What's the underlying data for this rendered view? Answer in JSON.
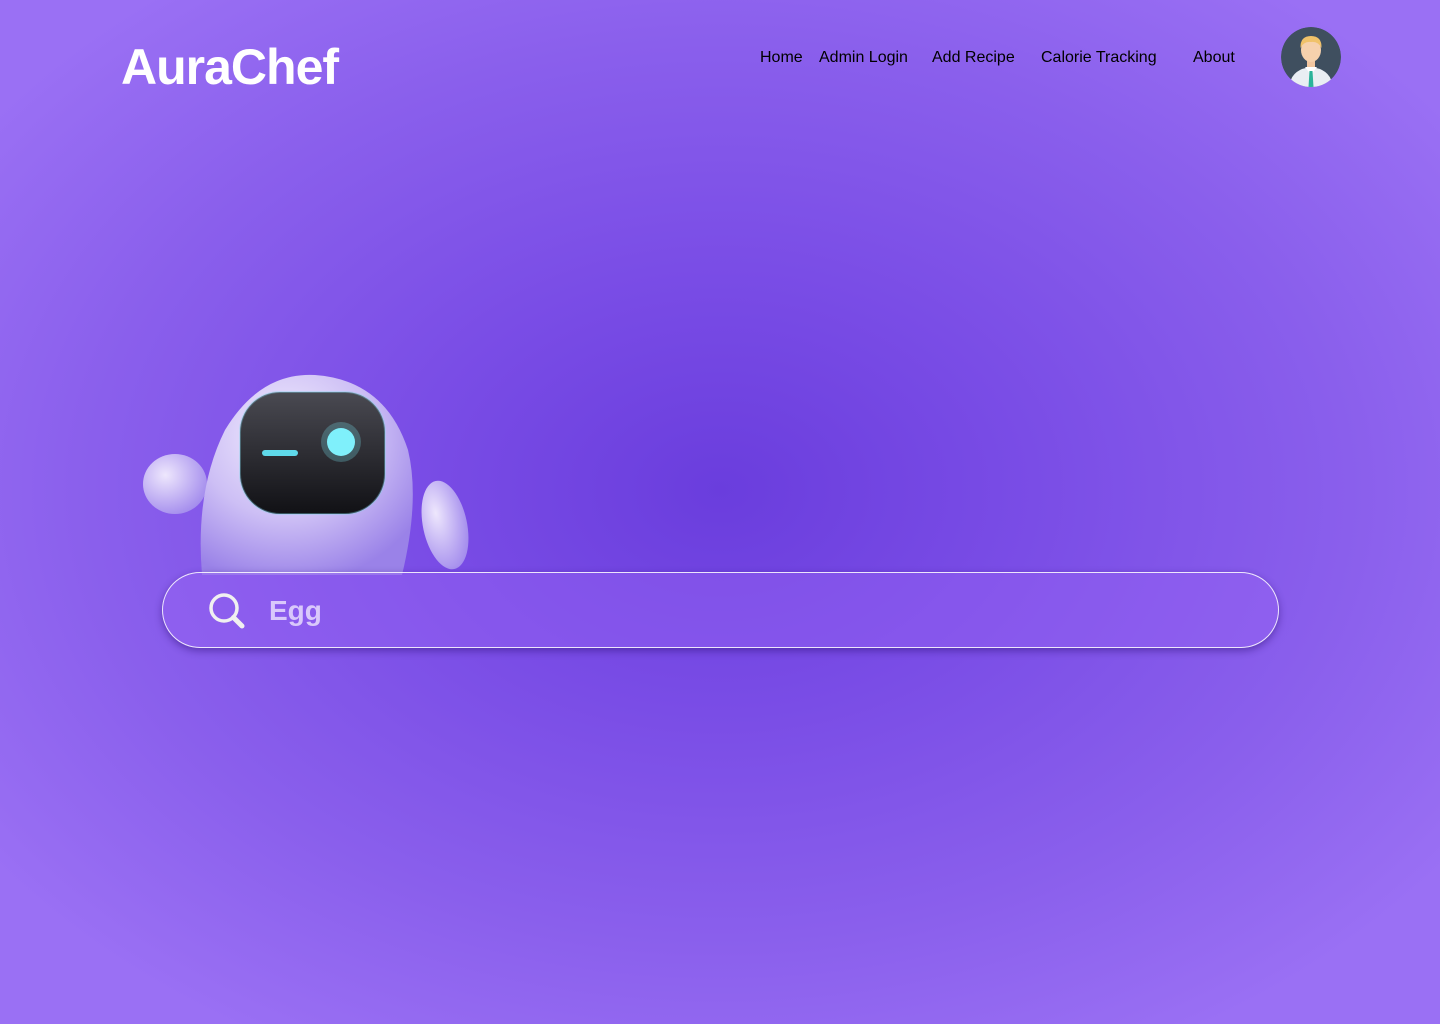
{
  "app": {
    "brand": "AuraChef"
  },
  "nav": {
    "items": [
      {
        "label": "Home"
      },
      {
        "label": "Admin Login"
      },
      {
        "label": "Add Recipe"
      },
      {
        "label": "Calorie Tracking"
      },
      {
        "label": "About"
      }
    ]
  },
  "user": {
    "avatar_icon": "user-avatar-icon"
  },
  "hero": {
    "mascot_icon": "robot-mascot-icon"
  },
  "search": {
    "value": "Egg",
    "icon": "search-icon"
  },
  "colors": {
    "background_center": "#6a3ddd",
    "background_edge": "#9a70f4",
    "text": "#ffffff",
    "search_text": "#d9c8fb"
  }
}
